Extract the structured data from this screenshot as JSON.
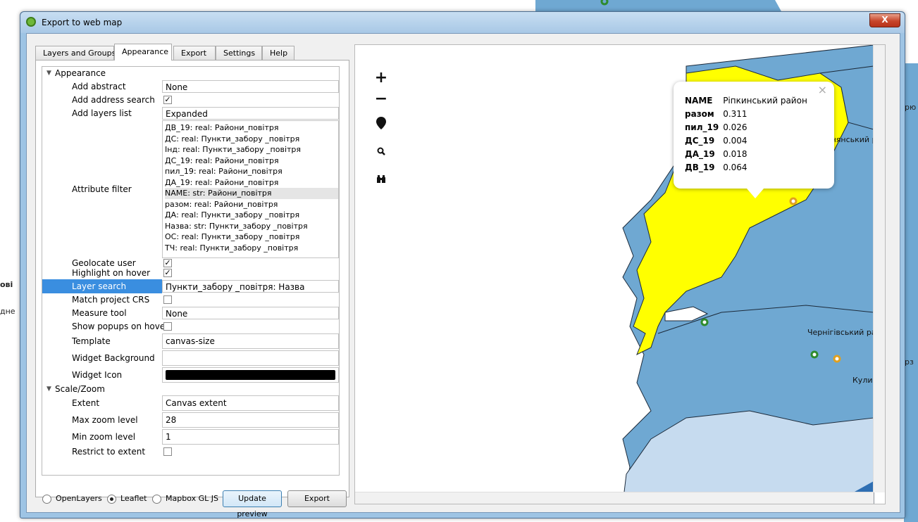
{
  "window": {
    "title": "Export to web map",
    "close_label": "X"
  },
  "tabs": [
    {
      "label": "Layers and Groups"
    },
    {
      "label": "Appearance"
    },
    {
      "label": "Export"
    },
    {
      "label": "Settings"
    },
    {
      "label": "Help"
    }
  ],
  "tree": {
    "appearance": {
      "label": "Appearance",
      "add_abstract": {
        "label": "Add abstract",
        "value": "None"
      },
      "add_address_search": {
        "label": "Add address search",
        "checked": "✓"
      },
      "add_layers_list": {
        "label": "Add layers list",
        "value": "Expanded"
      },
      "attribute_filter": {
        "label": "Attribute filter",
        "items": [
          "ДВ_19: real: Райони_повітря",
          "ДС: real: Пункти_забору _повітря",
          "Інд: real: Пункти_забору _повітря",
          "ДС_19: real: Райони_повітря",
          "пил_19: real: Райони_повітря",
          "ДА_19: real: Райони_повітря",
          "NAME: str: Райони_повітря",
          "разом: real: Райони_повітря",
          "ДА: real: Пункти_забору _повітря",
          "Назва: str: Пункти_забору _повітря",
          "ОС: real: Пункти_забору _повітря",
          "ТЧ: real: Пункти_забору _повітря"
        ]
      },
      "geolocate_user": {
        "label": "Geolocate user",
        "checked": "✓"
      },
      "highlight_on_hover": {
        "label": "Highlight on hover",
        "checked": "✓"
      },
      "layer_search": {
        "label": "Layer search",
        "value": "Пункти_забору _повітря: Назва"
      },
      "match_project_crs": {
        "label": "Match project CRS"
      },
      "measure_tool": {
        "label": "Measure tool",
        "value": "None"
      },
      "show_popups_on_hover": {
        "label": "Show popups on hover"
      },
      "template": {
        "label": "Template",
        "value": "canvas-size"
      },
      "widget_background": {
        "label": "Widget Background"
      },
      "widget_icon": {
        "label": "Widget Icon",
        "color": "#000000"
      }
    },
    "scale_zoom": {
      "label": "Scale/Zoom",
      "extent": {
        "label": "Extent",
        "value": "Canvas extent"
      },
      "max_zoom": {
        "label": "Max zoom level",
        "value": "28"
      },
      "min_zoom": {
        "label": "Min zoom level",
        "value": "1"
      },
      "restrict": {
        "label": "Restrict to extent"
      }
    }
  },
  "bottom": {
    "openlayers": "OpenLayers",
    "leaflet": "Leaflet",
    "mapbox": "Mapbox GL JS",
    "update_preview": "Update preview",
    "export": "Export",
    "selected": "Leaflet"
  },
  "map": {
    "zoom_in": "+",
    "zoom_out": "−",
    "popup": {
      "close": "×",
      "rows": [
        {
          "k": "NAME",
          "v": "Ріпкинський район"
        },
        {
          "k": "разом",
          "v": "0.311"
        },
        {
          "k": "пил_19",
          "v": "0.026"
        },
        {
          "k": "ДС_19",
          "v": "0.004"
        },
        {
          "k": "ДА_19",
          "v": "0.018"
        },
        {
          "k": "ДВ_19",
          "v": "0.064"
        }
      ]
    },
    "labels": {
      "chernihiv": "Чернігівський район",
      "kulik": "Куликів",
      "partial": "днянський рай"
    },
    "colors": {
      "highlight": "#ffff00",
      "district": "#6fa8d2",
      "district_light": "#c6dbef",
      "point_green": "#2e8b2e",
      "point_orange": "#e0a020"
    }
  },
  "background": {
    "left_1": "ові",
    "left_2": "дне",
    "right_1": "рю",
    "right_2": "рз"
  }
}
